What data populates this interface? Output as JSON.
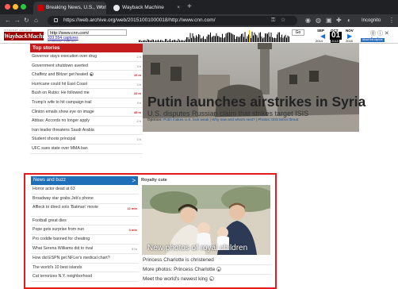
{
  "colors": {
    "cnn_red": "#c41c1c",
    "highlight_red": "#e51b1b",
    "wayback_red": "#9a0000",
    "news_blue": "#1e6fb7"
  },
  "browser": {
    "tabs": [
      {
        "title": "Breaking News, U.S., World, I",
        "icon": "cnn-favicon"
      },
      {
        "title": "Wayback Machine",
        "icon": "archive-favicon"
      }
    ],
    "new_tab": "+",
    "url": "https://web.archive.org/web/20151001000018/http://www.cnn.com/",
    "profile_label": "Incognito"
  },
  "wayback": {
    "logo_top": "INTERNET ARCHIVE",
    "logo": "WaybackMachine",
    "url_input": "http://www.cnn.com/",
    "captures": "333,554 captures",
    "date_range": "20 Jun 2000 - 1 Dec 2017",
    "go_label": "Go",
    "months": [
      "SEP",
      "OCT",
      "NOV"
    ],
    "day": "01",
    "years": [
      "2014",
      "2015",
      "2016"
    ],
    "about_label": "About this capture"
  },
  "top_stories": {
    "header": "Top stories",
    "items": [
      {
        "text": "Governor stays execution over drug",
        "time": "2 h",
        "hot": false,
        "play": false
      },
      {
        "text": "Government shutdown averted",
        "time": "3 h",
        "hot": false,
        "play": false
      },
      {
        "text": "Chaffetz and Blitzer get heated",
        "time": "10 m",
        "hot": true,
        "play": true
      },
      {
        "text": "Hurricane could hit East Coast",
        "time": "3 h",
        "hot": false,
        "play": false
      },
      {
        "text": "Bush on Rubio: He followed me",
        "time": "22 m",
        "hot": true,
        "play": false
      },
      {
        "text": "Trump's wife to hit campaign trail",
        "time": "3 h",
        "hot": false,
        "play": false
      },
      {
        "text": "Clinton emails show eye on image",
        "time": "45 m",
        "hot": true,
        "play": false
      },
      {
        "text": "Abbas: Accords no longer apply",
        "time": "2 h",
        "hot": false,
        "play": false
      },
      {
        "text": "Iran leader threatens Saudi Arabia",
        "time": "",
        "hot": false,
        "play": false
      },
      {
        "text": "Student shoots principal",
        "time": "3 h",
        "hot": false,
        "play": false
      },
      {
        "text": "UFC sues state over MMA ban",
        "time": "",
        "hot": false,
        "play": false
      }
    ]
  },
  "hero": {
    "headline": "Putin launches airstrikes in Syria",
    "subhead": "U.S. disputes Russian claim that strikes target ISIS",
    "opinion_label": "Opinion:",
    "links": "Putin makes U.S. look weak | Why now and what's next? | Photos: ISIS terror threat"
  },
  "news_buzz": {
    "header": "News and buzz",
    "chevron": ">",
    "items": [
      {
        "text": "Horror actor dead at 63",
        "time": "",
        "hot": false
      },
      {
        "text": "Broadway star grabs Jeb's phone",
        "time": "",
        "hot": false
      },
      {
        "text": "Affleck to direct solo 'Batman' movie",
        "time": "12 min",
        "hot": true
      },
      {
        "text": "Football great dies",
        "time": "",
        "hot": false
      },
      {
        "text": "Pope gets surprise from nun",
        "time": "3 min",
        "hot": true
      },
      {
        "text": "Pro coddle banned for cheating",
        "time": "",
        "hot": false
      },
      {
        "text": "What Serena Williams did to rival",
        "time": "5 hr",
        "hot": false
      },
      {
        "text": "How did ESPN get NFLer's medical chart?",
        "time": "",
        "hot": false
      },
      {
        "text": "The world's 10 best islands",
        "time": "",
        "hot": false
      },
      {
        "text": "Cat terrorizes N.Y. neighborhood",
        "time": "",
        "hot": false
      }
    ]
  },
  "royal": {
    "header": "Royalty cute",
    "caption": "New photos of royal children",
    "links": [
      {
        "text": "Princess Charlotte is christened",
        "play": false
      },
      {
        "text": "More photos: Princess Charlotte",
        "play": true
      },
      {
        "text": "Meet the world's newest king",
        "play": true
      }
    ],
    "play_glyph": "▶"
  }
}
